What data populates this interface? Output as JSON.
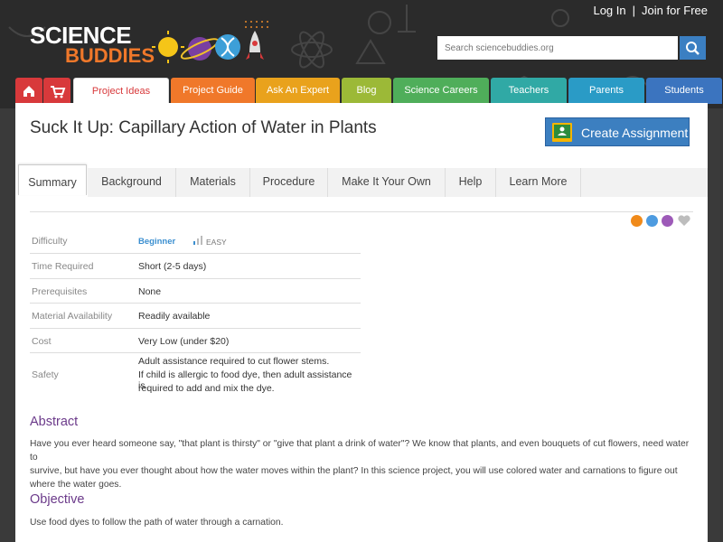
{
  "header": {
    "logo_line1": "SCIENCE",
    "logo_line2": "BUDDIES",
    "login": "Log In",
    "join": "Join for Free",
    "search_placeholder": "Search sciencebuddies.org"
  },
  "nav": {
    "home_icon": "home-icon",
    "cart_icon": "cart-icon",
    "tabs": [
      "Project Ideas",
      "Project Guide",
      "Ask An Expert",
      "Blog",
      "Science Careers",
      "Teachers",
      "Parents",
      "Students"
    ]
  },
  "page": {
    "title": "Suck It Up: Capillary Action of Water in Plants",
    "create_assignment": "Create Assignment"
  },
  "tabs": [
    "Summary",
    "Background",
    "Materials",
    "Procedure",
    "Make It Your Own",
    "Help",
    "Learn More"
  ],
  "share_icons": [
    "share-icon",
    "print-icon",
    "email-icon",
    "favorite-heart-icon"
  ],
  "summary": {
    "difficulty_label": "Difficulty",
    "difficulty_value": "Beginner",
    "difficulty_easy": "EASY",
    "time_label": "Time Required",
    "time_value": "Short (2-5 days)",
    "prereq_label": "Prerequisites",
    "prereq_value": "None",
    "material_label": "Material Availability",
    "material_value": "Readily available",
    "cost_label": "Cost",
    "cost_value": "Very Low (under $20)",
    "safety_label": "Safety",
    "safety_line1": "Adult assistance required to cut flower stems.",
    "safety_line2": "If child is allergic to food dye, then adult assistance is",
    "safety_line3": "required to add and mix the dye."
  },
  "abstract": {
    "heading": "Abstract",
    "line1": "Have you ever heard someone say, \"that plant is thirsty\" or \"give that plant a drink of water\"? We know that plants, and even bouquets of cut flowers, need water to",
    "line2": "survive, but have you ever thought about how the water moves within the plant? In this science project, you will use colored water and carnations to figure out",
    "line3": "where the water goes."
  },
  "objective": {
    "heading": "Objective",
    "text": "Use food dyes to follow the path of water through a carnation."
  },
  "colors": {
    "nav_home": "#d8393b",
    "nav_project_ideas_bg": "#ffffff",
    "nav_project_guide": "#f0782a",
    "nav_ask": "#e9a21c",
    "nav_blog": "#9cb937",
    "nav_careers": "#4fae5a",
    "nav_teachers": "#30a9a5",
    "nav_parents": "#2a9bc6",
    "nav_students": "#3b74bf",
    "heading_purple": "#6b3a8a",
    "button_blue": "#3c7fc0"
  }
}
